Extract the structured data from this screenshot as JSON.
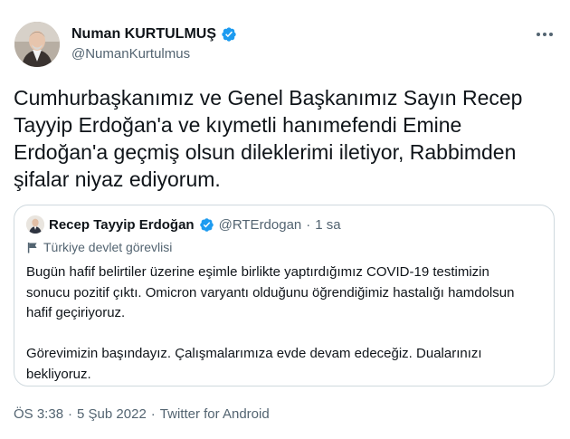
{
  "author": {
    "name": "Numan KURTULMUŞ",
    "handle": "@NumanKurtulmus"
  },
  "tweet": {
    "text": "Cumhurbaşkanımız ve Genel Başkanımız Sayın Recep\nTayyip Erdoğan'a ve kıymetli hanımefendi Emine\nErdoğan'a geçmiş olsun dileklerimi iletiyor, Rabbimden\nşifalar niyaz ediyorum."
  },
  "quoted": {
    "name": "Recep Tayyip Erdoğan",
    "handle": "@RTErdogan",
    "separator": "·",
    "time": "1 sa",
    "label": "Türkiye devlet görevlisi",
    "text": "Bugün hafif belirtiler üzerine eşimle birlikte yaptırdığımız COVID-19 testimizin\nsonucu pozitif çıktı. Omicron varyantı olduğunu öğrendiğimiz hastalığı hamdolsun\nhafif geçiriyoruz.\n\nGörevimizin başındayız. Çalışmalarımıza evde devam edeceğiz. Dualarınızı\nbekliyoruz."
  },
  "footer": {
    "time": "ÖS 3:38",
    "dot1": "·",
    "date": "5 Şub 2022",
    "dot2": "·",
    "source": "Twitter for Android"
  },
  "icons": {
    "more": "more-icon",
    "verified": "verified-badge-icon",
    "label": "flag-icon"
  },
  "colors": {
    "verified_blue": "#1d9bf0",
    "secondary_text": "#536471",
    "border": "#cfd9de"
  }
}
